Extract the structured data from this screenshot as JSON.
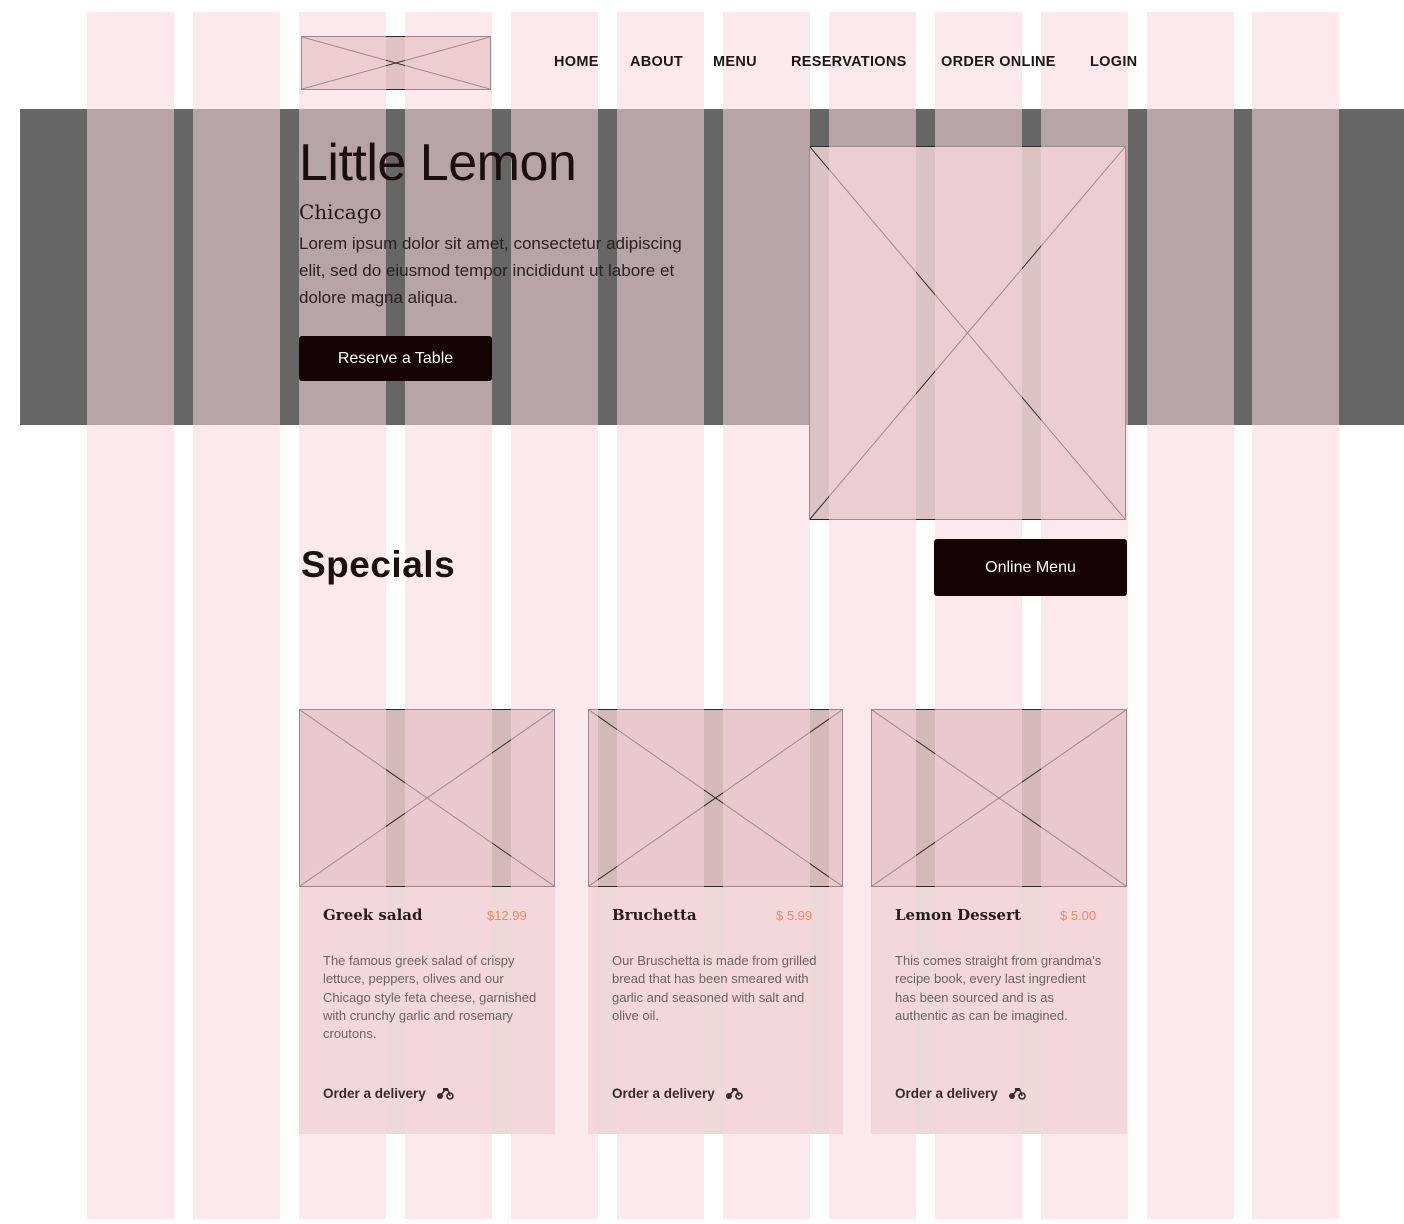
{
  "header": {
    "nav": [
      {
        "label": "HOME"
      },
      {
        "label": "ABOUT"
      },
      {
        "label": "MENU"
      },
      {
        "label": "RESERVATIONS"
      },
      {
        "label": "ORDER ONLINE"
      },
      {
        "label": "LOGIN"
      }
    ]
  },
  "hero": {
    "title": "Little Lemon",
    "city": "Chicago",
    "description": "Lorem ipsum dolor sit amet, consectetur adipiscing elit, sed do eiusmod tempor incididunt ut labore et dolore magna aliqua.",
    "reserve_label": "Reserve a Table"
  },
  "specials": {
    "title": "Specials",
    "menu_button_label": "Online Menu",
    "cards": [
      {
        "title": "Greek salad",
        "price": "$12.99",
        "description": "The famous greek salad of crispy lettuce, peppers, olives and our Chicago style feta cheese, garnished with crunchy garlic and rosemary croutons.",
        "link": "Order a delivery"
      },
      {
        "title": "Bruchetta",
        "price": "$ 5.99",
        "description": "Our Bruschetta is made from grilled bread that has been smeared with garlic and seasoned with salt and olive oil.",
        "link": "Order a delivery"
      },
      {
        "title": "Lemon Dessert",
        "price": "$ 5.00",
        "description": "This comes straight from grandma's recipe book, every last ingredient has been sourced and is as authentic as can be imagined.",
        "link": "Order a delivery"
      }
    ]
  },
  "colors": {
    "hero_band": "#666666",
    "button_dark": "#160405",
    "price_accent": "#ee8d5a",
    "grid_overlay": "#fad7de",
    "placeholder_fill": "#d8bcbc"
  },
  "icons": [
    "image-placeholder-icon",
    "delivery-bike-icon"
  ]
}
